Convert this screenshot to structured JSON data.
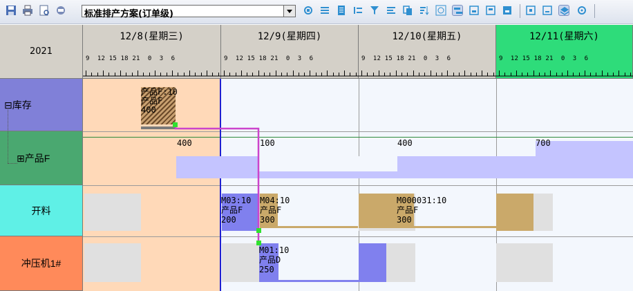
{
  "toolbar": {
    "plan_select": "标准排产方案(订单级)"
  },
  "timeline": {
    "year": "2021",
    "days": [
      {
        "label": "12/8(星期三)",
        "hours": "9  12 15 18 21  0  3  6"
      },
      {
        "label": "12/9(星期四)",
        "hours": "9  12 15 18 21  0  3  6"
      },
      {
        "label": "12/10(星期五)",
        "hours": "9  12 15 18 21  0  3  6"
      },
      {
        "label": "12/11(星期六)",
        "hours": "9  12 15 18 21  0  3  6"
      }
    ]
  },
  "rows": {
    "inventory": "⊟库存",
    "product_f": "⊞产品F",
    "cutting": "开料",
    "press": "冲压机1#"
  },
  "inventory_task": {
    "line1": "产品F:10",
    "line2": "产品F",
    "line3": "400"
  },
  "stock_levels": [
    "400",
    "100",
    "400",
    "700"
  ],
  "cutting_tasks": [
    {
      "line1": "M03:10",
      "line2": "产品F",
      "line3": "200"
    },
    {
      "line1": "M04:10",
      "line2": "产品F",
      "line3": "300"
    },
    {
      "line1": "M000031:10",
      "line2": "产品F",
      "line3": "300"
    }
  ],
  "press_task": {
    "line1": "M01:10",
    "line2": "产品D",
    "line3": "250"
  },
  "colors": {
    "inventory_row": "#8080d8",
    "product_row": "#4aa870",
    "cutting_row": "#5ff0e6",
    "press_row": "#ff8a5a",
    "weekend_day": "#2edc7a",
    "past_shade": "#ffd9b8",
    "stock_bar": "#c4c4ff",
    "task_blue": "#8080ee",
    "task_tan": "#caa96a",
    "link": "#cc44cc"
  }
}
